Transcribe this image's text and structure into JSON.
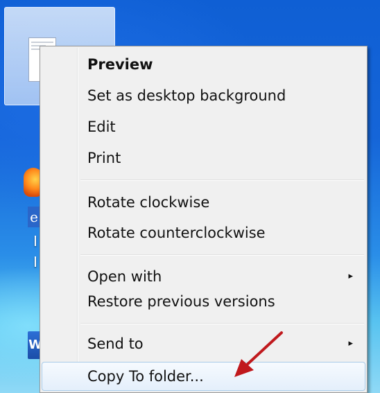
{
  "desktop": {
    "selected_file_icon": "image-file-icon",
    "other_icons": [
      "firefox-icon",
      "internet-explorer-icon",
      "word-icon"
    ],
    "partial_labels": [
      "I",
      "I"
    ]
  },
  "context_menu": {
    "items": [
      {
        "label": "Preview",
        "bold": true
      },
      {
        "label": "Set as desktop background"
      },
      {
        "label": "Edit"
      },
      {
        "label": "Print"
      },
      {
        "label": "Rotate clockwise"
      },
      {
        "label": "Rotate counterclockwise"
      },
      {
        "label": "Open with",
        "submenu_arrow": "▸"
      },
      {
        "label": "Restore previous versions"
      },
      {
        "label": "Send to",
        "submenu_arrow": "▸"
      },
      {
        "label": "Copy To folder...",
        "highlighted": true
      }
    ]
  },
  "annotation": {
    "arrow_color": "#c0191d",
    "points_to": "Copy To folder..."
  },
  "colors": {
    "menu_background": "#f0f0f0",
    "menu_border": "#979797",
    "hover_border": "#a8cbe9",
    "desktop_blue": "#1565d8"
  }
}
